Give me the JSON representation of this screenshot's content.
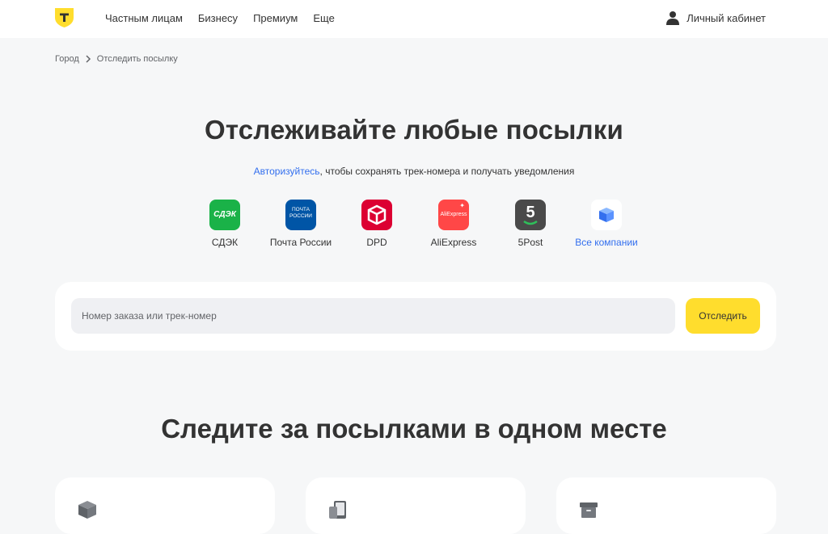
{
  "header": {
    "logo_icon": "tbank-shield-logo-icon",
    "nav": [
      "Частным лицам",
      "Бизнесу",
      "Премиум",
      "Еще"
    ],
    "account_label": "Личный кабинет",
    "account_icon": "user-icon"
  },
  "breadcrumb": {
    "items": [
      "Город",
      "Отследить посылку"
    ],
    "separator_icon": "chevron-right-icon"
  },
  "main": {
    "title": "Отслеживайте любые посылки",
    "subtitle_link": "Авторизуйтесь",
    "subtitle_rest": ", чтобы сохранять трек-номера и получать уведомления",
    "carriers": [
      {
        "label": "СДЭК",
        "icon": "cdek-logo-icon",
        "icon_text": "СДЭК",
        "color": "#1ab248"
      },
      {
        "label": "Почта России",
        "icon": "russian-post-logo-icon",
        "icon_text": "ПОЧТА РОССИИ",
        "color": "#0055a6"
      },
      {
        "label": "DPD",
        "icon": "dpd-logo-icon",
        "color": "#dc0032"
      },
      {
        "label": "AliExpress",
        "icon": "aliexpress-logo-icon",
        "icon_text": "AliExpress",
        "color": "#ff4747"
      },
      {
        "label": "5Post",
        "icon": "5post-logo-icon",
        "icon_text": "5",
        "color": "#4a4a4a"
      },
      {
        "label": "Все компании",
        "icon": "parcel-box-icon",
        "color": "#336fee"
      }
    ]
  },
  "search": {
    "placeholder": "Номер заказа или трек-номер",
    "button_label": "Отследить",
    "button_color": "#ffdd2d"
  },
  "features": {
    "title": "Следите за посылками в одном месте",
    "cards": [
      {
        "icon": "package-icon"
      },
      {
        "icon": "devices-icon"
      },
      {
        "icon": "archive-box-icon"
      }
    ]
  }
}
